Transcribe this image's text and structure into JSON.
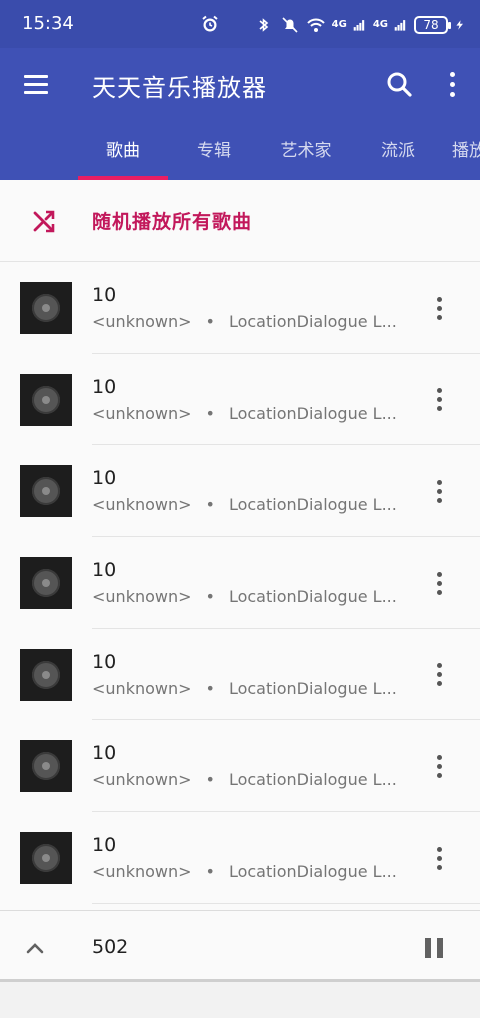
{
  "status_bar": {
    "time": "15:34",
    "signal_label_1": "4G",
    "signal_label_2": "4G",
    "battery": "78"
  },
  "toolbar": {
    "title": "天天音乐播放器",
    "menu_icon": "hamburger-menu-icon",
    "search_icon": "search-icon",
    "more_icon": "more-vert-icon"
  },
  "tabs": [
    {
      "label": "歌曲",
      "active": true
    },
    {
      "label": "专辑",
      "active": false
    },
    {
      "label": "艺术家",
      "active": false
    },
    {
      "label": "流派",
      "active": false
    },
    {
      "label": "播放",
      "active": false
    }
  ],
  "shuffle": {
    "label": "随机播放所有歌曲",
    "icon": "shuffle-icon"
  },
  "songs": [
    {
      "title": "10",
      "artist": "<unknown>",
      "separator": "•",
      "album": "LocationDialogue L..."
    },
    {
      "title": "10",
      "artist": "<unknown>",
      "separator": "•",
      "album": "LocationDialogue L..."
    },
    {
      "title": "10",
      "artist": "<unknown>",
      "separator": "•",
      "album": "LocationDialogue L..."
    },
    {
      "title": "10",
      "artist": "<unknown>",
      "separator": "•",
      "album": "LocationDialogue L..."
    },
    {
      "title": "10",
      "artist": "<unknown>",
      "separator": "•",
      "album": "LocationDialogue L..."
    },
    {
      "title": "10",
      "artist": "<unknown>",
      "separator": "•",
      "album": "LocationDialogue L..."
    },
    {
      "title": "10",
      "artist": "<unknown>",
      "separator": "•",
      "album": "LocationDialogue L..."
    }
  ],
  "mini_player": {
    "title": "502",
    "expand_icon": "chevron-up-icon",
    "pause_icon": "pause-icon"
  },
  "colors": {
    "primary": "#3f51b5",
    "accent": "#e91e63",
    "shuffle_text": "#c2185b"
  }
}
